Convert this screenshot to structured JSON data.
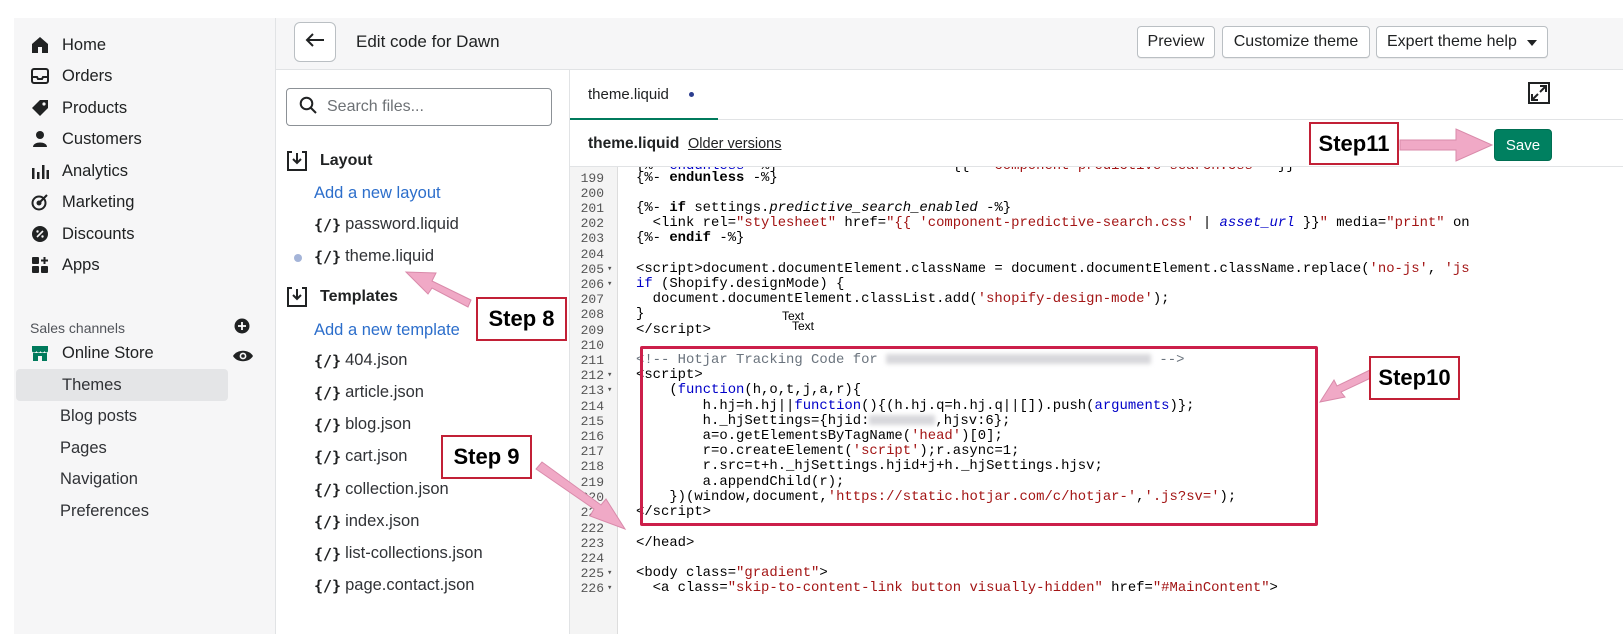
{
  "admin_nav": {
    "items": [
      {
        "label": "Home",
        "icon": "home-icon"
      },
      {
        "label": "Orders",
        "icon": "orders-icon"
      },
      {
        "label": "Products",
        "icon": "tag-icon"
      },
      {
        "label": "Customers",
        "icon": "person-icon"
      },
      {
        "label": "Analytics",
        "icon": "bar-chart-icon"
      },
      {
        "label": "Marketing",
        "icon": "target-icon"
      },
      {
        "label": "Discounts",
        "icon": "discount-icon"
      },
      {
        "label": "Apps",
        "icon": "apps-icon"
      }
    ],
    "sales_channels_title": "Sales channels",
    "online_store": "Online Store",
    "sub_items": [
      "Themes",
      "Blog posts",
      "Pages",
      "Navigation",
      "Preferences"
    ]
  },
  "topbar": {
    "title": "Edit code for Dawn",
    "preview": "Preview",
    "customize": "Customize theme",
    "expert_help": "Expert theme help"
  },
  "file_panel": {
    "search_placeholder": "Search files...",
    "layout_folder": "Layout",
    "add_layout": "Add a new layout",
    "layout_files": [
      "password.liquid",
      "theme.liquid"
    ],
    "templates_folder": "Templates",
    "add_template": "Add a new template",
    "template_files": [
      "404.json",
      "article.json",
      "blog.json",
      "cart.json",
      "collection.json",
      "index.json",
      "list-collections.json",
      "page.contact.json"
    ],
    "file_type_glyph": "{/}"
  },
  "editor": {
    "tab_label": "theme.liquid",
    "file_name": "theme.liquid",
    "older_versions": "Older versions",
    "save": "Save",
    "line_numbers": [
      "199",
      "200",
      "201",
      "202",
      "203",
      "204",
      "205",
      "206",
      "207",
      "208",
      "209",
      "210",
      "211",
      "212",
      "213",
      "214",
      "215",
      "216",
      "217",
      "218",
      "219",
      "220",
      "221",
      "222",
      "223",
      "224",
      "225",
      "226"
    ]
  },
  "annotations": {
    "step8": "Step 8",
    "step9": "Step 9",
    "step10": "Step10",
    "step11": "Step11",
    "text_a": "Text",
    "text_b": "Text"
  },
  "colors": {
    "accent_green": "#008060",
    "link_blue": "#2c6ecb",
    "annotation_red": "#c22036",
    "arrow_pink": "#f0a9c6"
  }
}
